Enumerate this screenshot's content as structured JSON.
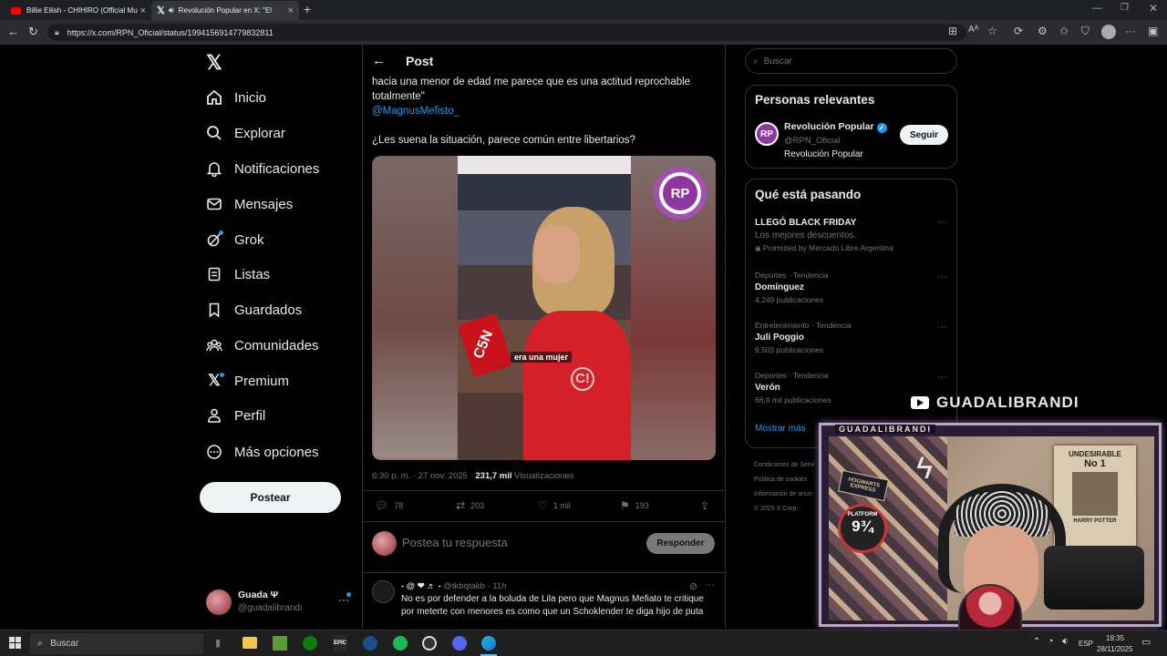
{
  "browser": {
    "tabs": [
      {
        "title": "Billie Eilish - CHIHIRO (Official Mu",
        "icon": "youtube-icon",
        "active": false
      },
      {
        "title": "Revolución Popular en X: \"El",
        "icon": "x-logo-icon",
        "active": true
      }
    ],
    "url": "https://x.com/RPN_Oficial/status/1994156914779832811"
  },
  "sidebar": {
    "items": [
      {
        "label": "Inicio",
        "icon": "home-icon"
      },
      {
        "label": "Explorar",
        "icon": "search-icon"
      },
      {
        "label": "Notificaciones",
        "icon": "bell-icon"
      },
      {
        "label": "Mensajes",
        "icon": "mail-icon"
      },
      {
        "label": "Grok",
        "icon": "grok-icon"
      },
      {
        "label": "Listas",
        "icon": "list-icon"
      },
      {
        "label": "Guardados",
        "icon": "bookmark-icon"
      },
      {
        "label": "Comunidades",
        "icon": "communities-icon"
      },
      {
        "label": "Premium",
        "icon": "x-premium-icon"
      },
      {
        "label": "Perfil",
        "icon": "profile-icon"
      },
      {
        "label": "Más opciones",
        "icon": "more-circle-icon"
      }
    ],
    "post_button": "Postear",
    "account": {
      "name": "Guada Ψ",
      "handle": "@guadalibrandi"
    }
  },
  "post": {
    "header": "Post",
    "text_line1": "hacia una menor de edad me parece que es una actitud reprochable",
    "text_line2": "totalmente\"",
    "mention": "@MagnusMefisto_",
    "question": "¿Les suena la situación, parece común entre libertarios?",
    "video_caption": "era una mujer",
    "badge": "RP",
    "mic_brand": "C5N",
    "time": "6:30 p. m. · 27 nov. 2025 · ",
    "views_count": "231,7 mil",
    "views_label": " Visualizaciones",
    "actions": {
      "replies": "78",
      "reposts": "203",
      "likes": "1 mil",
      "bookmarks": "193"
    },
    "reply_placeholder": "Postea tu respuesta",
    "reply_button": "Responder"
  },
  "reply": {
    "name": "- @ ❤ ♬ -",
    "handle": "@tkbqtakb",
    "time": "· 11h",
    "line1": "No es por defender a la boluda de Lila pero que Magnus Mefiato te critique",
    "line2": "por meterte con menores es como que un Schoklender te diga hijo de puta"
  },
  "right": {
    "search_placeholder": "Buscar",
    "relevant": {
      "title": "Personas relevantes",
      "name": "Revolución Popular",
      "handle": "@RPN_Oficial",
      "bio": "Revolución Popular",
      "follow": "Seguir",
      "avatar": "RP"
    },
    "trends": {
      "title": "Qué está pasando",
      "items": [
        {
          "meta": "",
          "title": "LLEGÓ BLACK FRIDAY",
          "sub": "Los mejores descuentos.",
          "extra": "Promoted by Mercado Libre Argentina"
        },
        {
          "meta": "Deportes · Tendencia",
          "title": "Domínguez",
          "sub": "4.249 publicaciones"
        },
        {
          "meta": "Entretenimiento · Tendencia",
          "title": "Juli Poggio",
          "sub": "9.503 publicaciones"
        },
        {
          "meta": "Deportes · Tendencia",
          "title": "Verón",
          "sub": "66,8 mil publicaciones"
        }
      ],
      "show_more": "Mostrar más"
    },
    "footer": [
      "Condiciones de Servi",
      "Política de cookies",
      "Información de anun",
      "© 2025 X Corp."
    ]
  },
  "overlay": {
    "channel": "GUADALIBRANDI",
    "frame_label": "GUADALIBRANDI",
    "poster_title": "UNDESIRABLE",
    "poster_no": "No 1",
    "poster_sub": "HARRY POTTER",
    "sign": "PLATFORM",
    "platform_num": "9¾",
    "hogwarts": "HOGWARTS EXPRESS"
  },
  "taskbar": {
    "search": "Buscar",
    "lang": "ESP",
    "time": "19:35",
    "date": "28/11/2025"
  }
}
